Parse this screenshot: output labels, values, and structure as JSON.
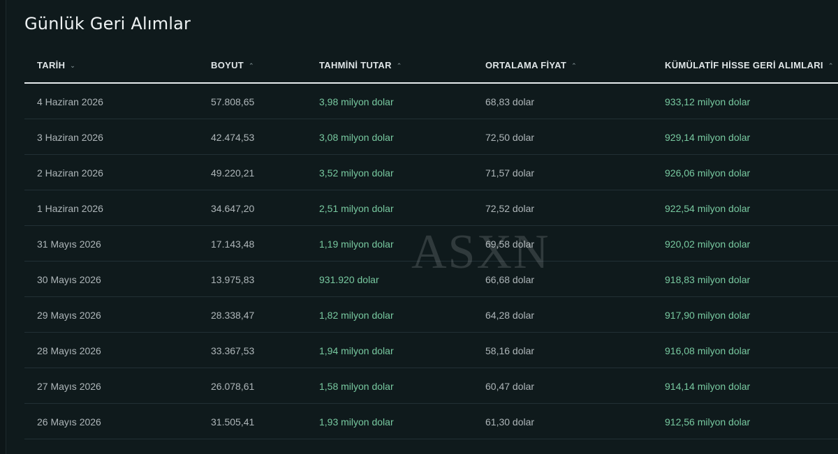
{
  "title": "Günlük Geri Alımlar",
  "columns": [
    {
      "label": "TARİH",
      "sort": "⌄"
    },
    {
      "label": "BOYUT",
      "sort": "⌃"
    },
    {
      "label": "TAHMİNİ TUTAR",
      "sort": "⌃"
    },
    {
      "label": "ORTALAMA FİYAT",
      "sort": "⌃"
    },
    {
      "label": "KÜMÜLATİF HİSSE GERİ ALIMLARI",
      "sort": "⌃"
    }
  ],
  "rows": [
    [
      "4 Haziran 2026",
      "57.808,65",
      "3,98 milyon dolar",
      "68,83 dolar",
      "933,12 milyon dolar"
    ],
    [
      "3 Haziran 2026",
      "42.474,53",
      "3,08 milyon dolar",
      "72,50 dolar",
      "929,14 milyon dolar"
    ],
    [
      "2 Haziran 2026",
      "49.220,21",
      "3,52 milyon dolar",
      "71,57 dolar",
      "926,06 milyon dolar"
    ],
    [
      "1 Haziran 2026",
      "34.647,20",
      "2,51 milyon dolar",
      "72,52 dolar",
      "922,54 milyon dolar"
    ],
    [
      "31 Mayıs 2026",
      "17.143,48",
      "1,19 milyon dolar",
      "69,58 dolar",
      "920,02 milyon dolar"
    ],
    [
      "30 Mayıs 2026",
      "13.975,83",
      "931.920 dolar",
      "66,68 dolar",
      "918,83 milyon dolar"
    ],
    [
      "29 Mayıs 2026",
      "28.338,47",
      "1,82 milyon dolar",
      "64,28 dolar",
      "917,90 milyon dolar"
    ],
    [
      "28 Mayıs 2026",
      "33.367,53",
      "1,94 milyon dolar",
      "58,16 dolar",
      "916,08 milyon dolar"
    ],
    [
      "27 Mayıs 2026",
      "26.078,61",
      "1,58 milyon dolar",
      "60,47 dolar",
      "914,14 milyon dolar"
    ],
    [
      "26 Mayıs 2026",
      "31.505,41",
      "1,93 milyon dolar",
      "61,30 dolar",
      "912,56 milyon dolar"
    ]
  ],
  "watermark": "ASXN",
  "colors": {
    "background": "#0f1a1c",
    "accent_green": "#78c9a0",
    "header_text": "#dfe5e7"
  }
}
